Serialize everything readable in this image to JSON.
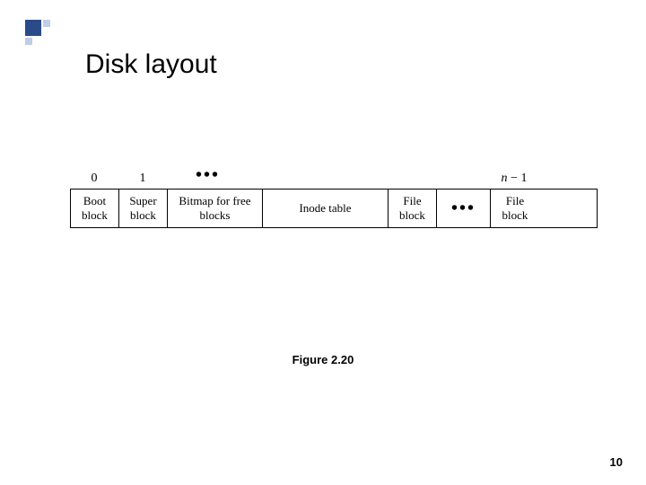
{
  "title": "Disk layout",
  "labels": {
    "l0": "0",
    "l1": "1",
    "ldots": "•••",
    "ln1_prefix": "n",
    "ln1_suffix": " − 1"
  },
  "cells": {
    "boot": "Boot block",
    "super": "Super block",
    "bitmap": "Bitmap for free blocks",
    "inode": "Inode table",
    "file1": "File block",
    "dots": "•••",
    "file2": "File block"
  },
  "caption": "Figure 2.20",
  "pagenum": "10"
}
